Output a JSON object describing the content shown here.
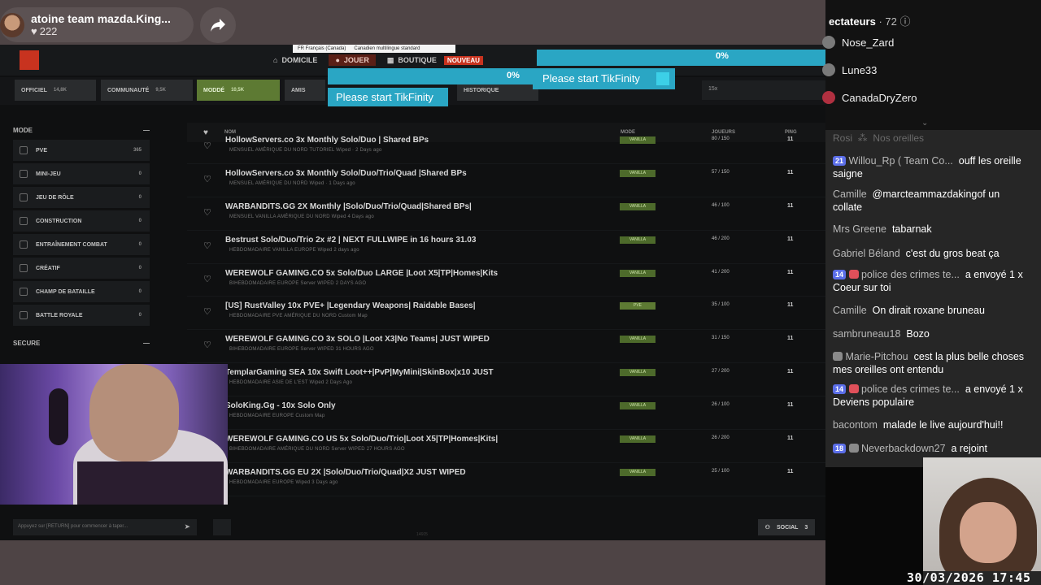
{
  "stream": {
    "title": "atoine team mazda.King...",
    "likes": "222"
  },
  "game": {
    "lang": [
      "FR Français (Canada)",
      "Canadien multilingue standard"
    ],
    "nav": [
      {
        "label": "DOMICILE"
      },
      {
        "label": "JOUER"
      },
      {
        "label": "BOUTIQUE"
      }
    ],
    "new_badge": "NOUVEAU",
    "filters": [
      {
        "label": "OFFICIEL",
        "count": "14,8K"
      },
      {
        "label": "COMMUNAUTÉ",
        "count": "9,5K"
      },
      {
        "label": "MODDÉ",
        "count": "10,5K"
      },
      {
        "label": "AMIS",
        "count": ""
      },
      {
        "label": "HISTORIQUE",
        "count": ""
      }
    ],
    "search_value": "15x",
    "sidebar": {
      "mode_header": "MODE",
      "mode_items": [
        {
          "label": "PVE",
          "count": "365"
        },
        {
          "label": "MINI-JEU",
          "count": "0"
        },
        {
          "label": "JEU DE RÔLE",
          "count": "0"
        },
        {
          "label": "CONSTRUCTION",
          "count": "0"
        },
        {
          "label": "ENTRAÎNEMENT COMBAT",
          "count": "0"
        },
        {
          "label": "CRÉATIF",
          "count": "0"
        },
        {
          "label": "CHAMP DE BATAILLE",
          "count": "0"
        },
        {
          "label": "BATTLE ROYALE",
          "count": "0"
        }
      ],
      "secure_header": "SECURE"
    },
    "columns": {
      "name": "NOM",
      "mode": "MODE",
      "players": "JOUEURS",
      "ping": "PING"
    },
    "servers": [
      {
        "name": "HollowServers.co 3x Monthly Solo/Duo | Shared BPs",
        "meta": "MENSUEL   AMÉRIQUE DU NORD   TUTORIEL   Wiped · 2 Days ago",
        "mode": "VANILLA",
        "players": "80 / 150",
        "ping": "11"
      },
      {
        "name": "HollowServers.co 3x Monthly Solo/Duo/Trio/Quad |Shared BPs",
        "meta": "MENSUEL   AMÉRIQUE DU NORD   Wiped · 1 Days ago",
        "mode": "VANILLA",
        "players": "57 / 150",
        "ping": "11"
      },
      {
        "name": "WARBANDITS.GG 2X Monthly |Solo/Duo/Trio/Quad|Shared BPs|",
        "meta": "MENSUEL   VANILLA   AMÉRIQUE DU NORD   Wiped 4 Days ago",
        "mode": "VANILLA",
        "players": "46 / 100",
        "ping": "11"
      },
      {
        "name": "Bestrust Solo/Duo/Trio 2x #2 | NEXT FULLWIPE in 16 hours 31.03",
        "meta": "HEBDOMADAIRE   VANILLA   EUROPE   Wiped 2 days ago",
        "mode": "VANILLA",
        "players": "46 / 200",
        "ping": "11"
      },
      {
        "name": "WEREWOLF GAMING.CO 5x Solo/Duo LARGE |Loot X5|TP|Homes|Kits",
        "meta": "BIHEBDOMADAIRE   EUROPE   Server WIPED 2 DAYS AGO",
        "mode": "VANILLA",
        "players": "41 / 200",
        "ping": "11"
      },
      {
        "name": "[US] RustValley 10x PVE+ |Legendary Weapons| Raidable Bases|",
        "meta": "HEBDOMADAIRE   PVE   AMÉRIQUE DU NORD   Custom Map",
        "mode": "PVE",
        "players": "35 / 100",
        "ping": "11"
      },
      {
        "name": "WEREWOLF GAMING.CO 3x SOLO |Loot X3|No Teams| JUST WIPED",
        "meta": "BIHEBDOMADAIRE   EUROPE   Server WIPED 31 HOURS AGO",
        "mode": "VANILLA",
        "players": "31 / 150",
        "ping": "11"
      },
      {
        "name": "TemplarGaming SEA 10x Swift Loot++|PvP|MyMini|SkinBox|x10 JUST",
        "meta": "HEBDOMADAIRE   ASIE DE L'EST   Wiped 2 Days Ago",
        "mode": "VANILLA",
        "players": "27 / 200",
        "ping": "11"
      },
      {
        "name": "SoloKing.Gg - 10x Solo Only",
        "meta": "HEBDOMADAIRE   EUROPE   Custom Map",
        "mode": "VANILLA",
        "players": "26 / 100",
        "ping": "11"
      },
      {
        "name": "WEREWOLF GAMING.CO US 5x Solo/Duo/Trio|Loot X5|TP|Homes|Kits|",
        "meta": "BIHEBDOMADAIRE   AMÉRIQUE DU NORD   Server WIPED 27 HOURS AGO",
        "mode": "VANILLA",
        "players": "26 / 200",
        "ping": "11"
      },
      {
        "name": "WARBANDITS.GG EU 2X |Solo/Duo/Trio/Quad|X2 JUST WIPED",
        "meta": "HEBDOMADAIRE   EUROPE   Wiped 3 Days ago",
        "mode": "VANILLA",
        "players": "25 / 100",
        "ping": "11"
      }
    ],
    "chat_placeholder": "Appuyez sur [RETURN] pour commencer à taper...",
    "social_label": "SOCIAL",
    "social_count": "3",
    "version": "14605"
  },
  "tikfinity": [
    {
      "text": "",
      "pct": "0%",
      "fill": 0
    },
    {
      "text": "Please start TikFinity",
      "pct": "0%",
      "fill": 0
    },
    {
      "text": "Please start TikFinity",
      "pct": "",
      "fill": 0
    }
  ],
  "chat": {
    "viewers_title": "ectateurs",
    "viewers_count": "· 72",
    "viewers": [
      "Nose_Zard",
      "Lune33",
      "CanadaDryZero"
    ],
    "faded_user": "Rosi",
    "faded_text": "Nos oreilles",
    "messages": [
      {
        "level": "21",
        "user": "Willou_Rp ( Team Co...",
        "text": "ouff les oreille saigne"
      },
      {
        "level": "",
        "user": "Camille",
        "text": "@marcteammazdakingof un collate"
      },
      {
        "level": "",
        "user": "Mrs Greene",
        "text": "tabarnak"
      },
      {
        "level": "",
        "user": "Gabriel Béland",
        "text": "c'est du gros beat ça"
      },
      {
        "level": "14",
        "user": "police des crimes te...",
        "text": "a envoyé 1 x Coeur sur toi"
      },
      {
        "level": "",
        "user": "Camille",
        "text": "On dirait roxane bruneau"
      },
      {
        "level": "",
        "user": "sambruneau18",
        "text": "Bozo"
      },
      {
        "level": "",
        "user": "Marie-Pitchou",
        "text": "cest la plus belle choses mes oreilles ont entendu"
      },
      {
        "level": "14",
        "user": "police des crimes te...",
        "text": "a envoyé 1 x Deviens populaire"
      },
      {
        "level": "",
        "user": "bacontom",
        "text": "malade le live aujourd'hui!!"
      },
      {
        "level": "18",
        "user": "Neverbackdown27",
        "text": "a rejoint"
      }
    ]
  },
  "timestamp": "30/03/2026 17:45"
}
